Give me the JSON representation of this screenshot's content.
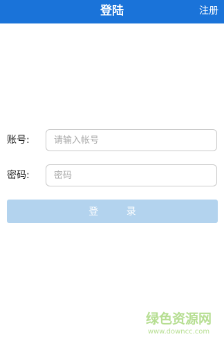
{
  "header": {
    "title": "登陆",
    "register_label": "注册"
  },
  "form": {
    "account": {
      "label": "账号:",
      "placeholder": "请输入帐号",
      "value": ""
    },
    "password": {
      "label": "密码:",
      "placeholder": "密码",
      "value": ""
    },
    "login_label": "登 录"
  },
  "watermark": {
    "main": "绿色资源网",
    "sub": "www.downcc.com"
  },
  "colors": {
    "header_bg": "#1a73d9",
    "button_bg": "#b3d3ee",
    "watermark": "#7cc43a"
  }
}
